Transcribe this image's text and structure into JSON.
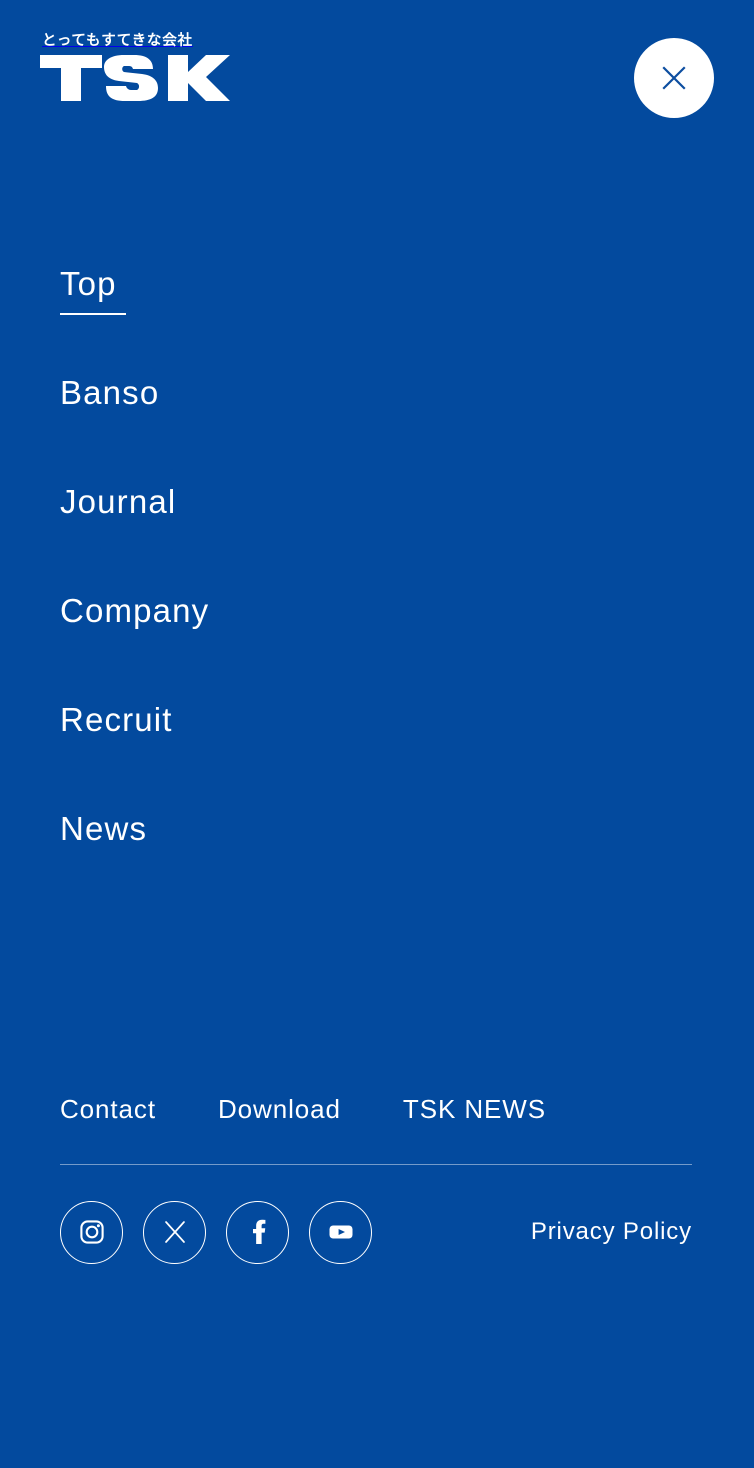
{
  "theme": {
    "background_color": "#034a9e",
    "text_color": "#ffffff",
    "accent_color": "#ffffff",
    "close_button_bg": "#ffffff",
    "close_icon_color": "#0d4ea0"
  },
  "header": {
    "logo": {
      "tagline": "とってもすてきな会社",
      "wordmark": "TSK",
      "icon_name": "tsk-logo"
    },
    "close_button": {
      "label": "Close",
      "icon_name": "close-icon"
    }
  },
  "nav": {
    "items": [
      {
        "label": "Top",
        "active": true
      },
      {
        "label": "Banso",
        "active": false
      },
      {
        "label": "Journal",
        "active": false
      },
      {
        "label": "Company",
        "active": false
      },
      {
        "label": "Recruit",
        "active": false
      },
      {
        "label": "News",
        "active": false
      }
    ]
  },
  "footer": {
    "links": [
      {
        "label": "Contact"
      },
      {
        "label": "Download"
      },
      {
        "label": "TSK NEWS"
      }
    ],
    "social": [
      {
        "name": "instagram",
        "icon_name": "instagram-icon"
      },
      {
        "name": "x",
        "icon_name": "x-twitter-icon"
      },
      {
        "name": "facebook",
        "icon_name": "facebook-icon"
      },
      {
        "name": "youtube",
        "icon_name": "youtube-icon"
      }
    ],
    "privacy_policy": "Privacy Policy"
  }
}
